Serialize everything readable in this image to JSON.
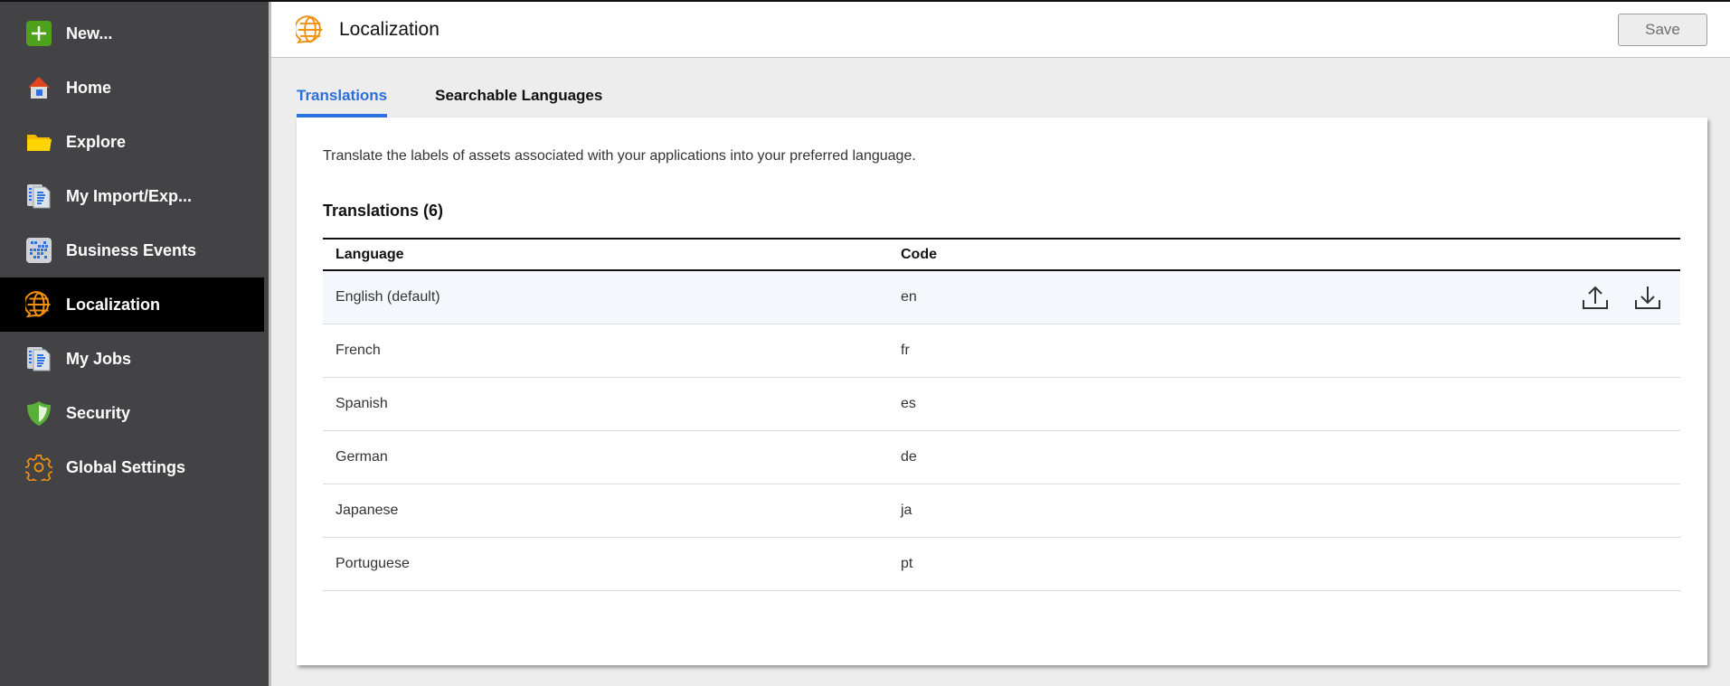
{
  "sidebar": {
    "items": [
      {
        "label": "New...",
        "icon": "plus-icon",
        "active": false
      },
      {
        "label": "Home",
        "icon": "home-icon",
        "active": false
      },
      {
        "label": "Explore",
        "icon": "folder-icon",
        "active": false
      },
      {
        "label": "My Import/Exp...",
        "icon": "documents-icon",
        "active": false
      },
      {
        "label": "Business Events",
        "icon": "business-events-icon",
        "active": false
      },
      {
        "label": "Localization",
        "icon": "globe-icon",
        "active": true
      },
      {
        "label": "My Jobs",
        "icon": "documents-icon",
        "active": false
      },
      {
        "label": "Security",
        "icon": "shield-icon",
        "active": false
      },
      {
        "label": "Global Settings",
        "icon": "gear-icon",
        "active": false
      }
    ]
  },
  "header": {
    "title": "Localization",
    "icon": "globe-icon",
    "save_label": "Save"
  },
  "tabs": [
    {
      "label": "Translations",
      "active": true
    },
    {
      "label": "Searchable Languages",
      "active": false
    }
  ],
  "main": {
    "description": "Translate the labels of assets associated with your applications into your preferred language.",
    "section_title": "Translations (6)",
    "table": {
      "columns": [
        "Language",
        "Code"
      ],
      "rows": [
        {
          "language": "English (default)",
          "code": "en",
          "actions": [
            "upload-icon",
            "download-icon"
          ]
        },
        {
          "language": "French",
          "code": "fr"
        },
        {
          "language": "Spanish",
          "code": "es"
        },
        {
          "language": "German",
          "code": "de"
        },
        {
          "language": "Japanese",
          "code": "ja"
        },
        {
          "language": "Portuguese",
          "code": "pt"
        }
      ]
    }
  },
  "colors": {
    "sidebar_bg": "#434244",
    "active_item_bg": "#000000",
    "accent_blue": "#2c72e0",
    "icon_orange": "#f29111",
    "new_green": "#4ea11b"
  }
}
